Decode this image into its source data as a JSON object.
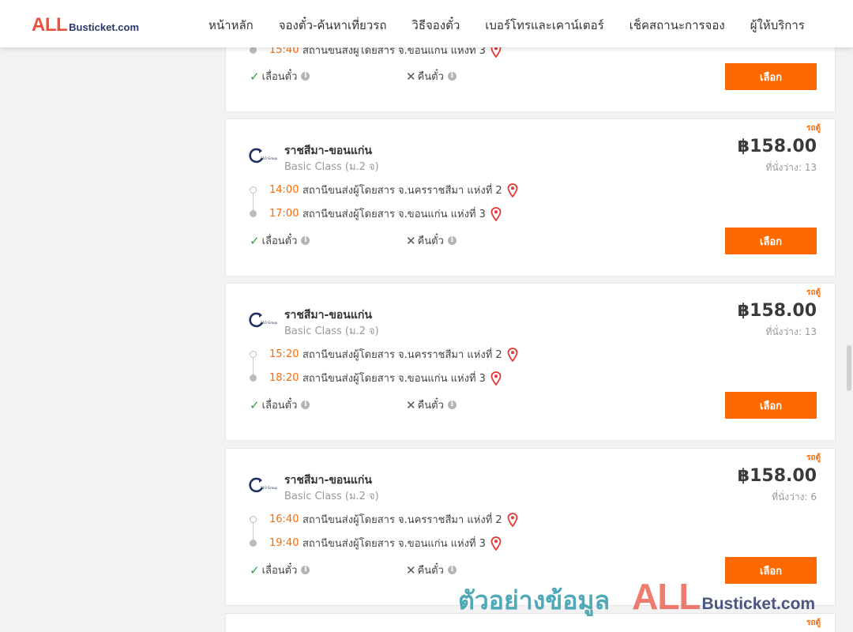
{
  "header": {
    "logo": {
      "all": "ALL",
      "rest": "Busticket.com"
    },
    "nav": [
      "หน้าหลัก",
      "จองตั๋ว-ค้นหาเที่ยวรถ",
      "วิธีจองตั๋ว",
      "เบอร์โทรและเคาน์เตอร์",
      "เช็คสถานะการจอง",
      "ผู้ให้บริการ"
    ]
  },
  "colors": {
    "accent": "#ff6a00",
    "logo_red": "#e8523f",
    "logo_navy": "#2b3a6b",
    "check": "#2aa640"
  },
  "partial_top": {
    "arrive_time": "15:40",
    "arrive_station": "สถานีขนส่งผู้โดยสาร จ.ขอนแก่น แห่งที่ 3",
    "reschedule": "เลื่อนตั๋ว",
    "refund": "คืนตั๋ว",
    "select": "เลือก"
  },
  "trips": [
    {
      "tag": "รถตู้",
      "route": "ราชสีมา-ขอนแก่น",
      "class": "Basic Class (ม.2 จ)",
      "price": "฿158.00",
      "seats_label": "ที่นั่งว่าง:",
      "seats": "13",
      "depart_time": "14:00",
      "depart_station": "สถานีขนส่งผู้โดยสาร จ.นครราชสีมา แห่งที่ 2",
      "arrive_time": "17:00",
      "arrive_station": "สถานีขนส่งผู้โดยสาร จ.ขอนแก่น แห่งที่ 3",
      "reschedule": "เลื่อนตั๋ว",
      "refund": "คืนตั๋ว",
      "select": "เลือก"
    },
    {
      "tag": "รถตู้",
      "route": "ราชสีมา-ขอนแก่น",
      "class": "Basic Class (ม.2 จ)",
      "price": "฿158.00",
      "seats_label": "ที่นั่งว่าง:",
      "seats": "13",
      "depart_time": "15:20",
      "depart_station": "สถานีขนส่งผู้โดยสาร จ.นครราชสีมา แห่งที่ 2",
      "arrive_time": "18:20",
      "arrive_station": "สถานีขนส่งผู้โดยสาร จ.ขอนแก่น แห่งที่ 3",
      "reschedule": "เลื่อนตั๋ว",
      "refund": "คืนตั๋ว",
      "select": "เลือก"
    },
    {
      "tag": "รถตู้",
      "route": "ราชสีมา-ขอนแก่น",
      "class": "Basic Class (ม.2 จ)",
      "price": "฿158.00",
      "seats_label": "ที่นั่งว่าง:",
      "seats": "6",
      "depart_time": "16:40",
      "depart_station": "สถานีขนส่งผู้โดยสาร จ.นครราชสีมา แห่งที่ 2",
      "arrive_time": "19:40",
      "arrive_station": "สถานีขนส่งผู้โดยสาร จ.ขอนแก่น แห่งที่ 3",
      "reschedule": "เลื่อนตั๋ว",
      "refund": "คืนตั๋ว",
      "select": "เลือก"
    }
  ],
  "partial_bottom": {
    "tag": "รถตู้"
  },
  "watermark": {
    "text": "ตัวอย่างข้อมูล",
    "all": "ALL",
    "rest": "Busticket.com"
  }
}
